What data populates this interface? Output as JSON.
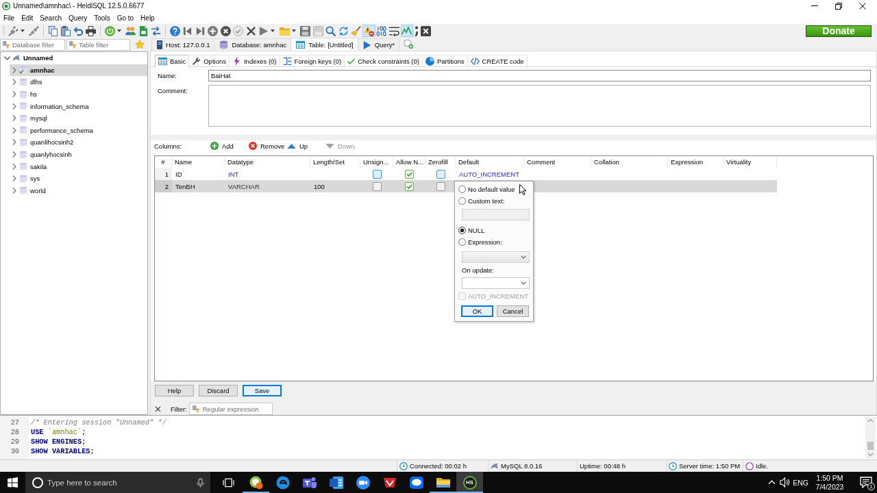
{
  "window": {
    "title": "Unnamed\\amnhac\\ - HeidiSQL 12.5.0.6677"
  },
  "menu": [
    "File",
    "Edit",
    "Search",
    "Query",
    "Tools",
    "Go to",
    "Help"
  ],
  "toolbar": {
    "groups": [
      [
        {
          "pressed": false,
          "dropdown": true
        },
        {
          "pressed": false,
          "dropdown": false
        }
      ],
      [
        {
          "pressed": false,
          "dropdown": false
        },
        {
          "pressed": false,
          "dropdown": false
        },
        {
          "pressed": false,
          "dropdown": false
        },
        {
          "pressed": false,
          "dropdown": false
        }
      ],
      [
        {
          "pressed": false,
          "dropdown": true
        },
        {
          "pressed": false,
          "dropdown": false
        },
        {
          "pressed": false,
          "dropdown": false
        },
        {
          "pressed": false,
          "dropdown": false
        }
      ],
      [
        {
          "pressed": false,
          "dropdown": false
        },
        {
          "pressed": false,
          "dropdown": false
        },
        {
          "pressed": false,
          "dropdown": false
        },
        {
          "pressed": false,
          "dropdown": false
        },
        {
          "pressed": false,
          "dropdown": false
        },
        {
          "pressed": false,
          "dropdown": false
        },
        {
          "pressed": false,
          "dropdown": false
        },
        {
          "pressed": false,
          "dropdown": true
        },
        {
          "pressed": false,
          "dropdown": true
        },
        {
          "pressed": false,
          "dropdown": false
        },
        {
          "pressed": false,
          "dropdown": false
        },
        {
          "pressed": false,
          "dropdown": false
        },
        {
          "pressed": false,
          "dropdown": false
        },
        {
          "pressed": false,
          "dropdown": false
        },
        {
          "pressed": true,
          "dropdown": false
        },
        {
          "pressed": false,
          "dropdown": false
        },
        {
          "pressed": false,
          "dropdown": false
        },
        {
          "pressed": true,
          "dropdown": false
        },
        {
          "pressed": false,
          "dropdown": false
        },
        {
          "pressed": false,
          "dropdown": false
        }
      ]
    ],
    "donate": "Donate"
  },
  "sidebar": {
    "database_filter": {
      "placeholder": "Database filter"
    },
    "table_filter": {
      "placeholder": "Table filter"
    },
    "tree": [
      {
        "label": "Unnamed",
        "expanded": true,
        "selected": false,
        "children": [
          {
            "label": "amnhac",
            "expanded": false,
            "selected": true,
            "active": true
          },
          {
            "label": "dlhs",
            "expanded": false,
            "selected": false,
            "active": false
          },
          {
            "label": "hs",
            "expanded": false,
            "selected": false,
            "active": false
          },
          {
            "label": "information_schema",
            "expanded": false,
            "selected": false,
            "active": false
          },
          {
            "label": "mysql",
            "expanded": false,
            "selected": false,
            "active": false
          },
          {
            "label": "performance_schema",
            "expanded": false,
            "selected": false,
            "active": false
          },
          {
            "label": "quanlihocsinh2",
            "expanded": false,
            "selected": false,
            "active": false
          },
          {
            "label": "quanlyhocsinh",
            "expanded": false,
            "selected": false,
            "active": false
          },
          {
            "label": "sakila",
            "expanded": false,
            "selected": false,
            "active": false
          },
          {
            "label": "sys",
            "expanded": false,
            "selected": false,
            "active": false
          },
          {
            "label": "world",
            "expanded": false,
            "selected": false,
            "active": false
          }
        ]
      }
    ]
  },
  "tabs": [
    {
      "kind": "host",
      "label": "Host: 127.0.0.1",
      "selected": false
    },
    {
      "kind": "database",
      "label": "Database: amnhac",
      "selected": false
    },
    {
      "kind": "table",
      "label": "Table: [Untitled]",
      "selected": true
    },
    {
      "kind": "query",
      "label": "Query*",
      "selected": false
    }
  ],
  "subtabs": [
    {
      "kind": "basic",
      "label": "Basic",
      "selected": true
    },
    {
      "kind": "options",
      "label": "Options",
      "selected": false
    },
    {
      "kind": "indexes",
      "label": "Indexes (0)",
      "selected": false
    },
    {
      "kind": "foreign_keys",
      "label": "Foreign keys (0)",
      "selected": false
    },
    {
      "kind": "check_constraints",
      "label": "Check constraints (0)",
      "selected": false
    },
    {
      "kind": "partitions",
      "label": "Partitions",
      "selected": false
    },
    {
      "kind": "create_code",
      "label": "CREATE code",
      "selected": false
    }
  ],
  "form": {
    "name": {
      "label": "Name:",
      "value": "BaiHat"
    },
    "comment": {
      "label": "Comment:"
    }
  },
  "columns_toolbar": {
    "label": "Columns:",
    "buttons": [
      {
        "kind": "add",
        "label": "Add",
        "disabled": false
      },
      {
        "kind": "remove",
        "label": "Remove",
        "disabled": false
      },
      {
        "kind": "up",
        "label": "Up",
        "disabled": false
      },
      {
        "kind": "down",
        "label": "Down",
        "disabled": true
      }
    ]
  },
  "grid": {
    "columns": [
      "#",
      "Name",
      "Datatype",
      "Length/Set",
      "Unsign...",
      "Allow N...",
      "Zerofill",
      "Default",
      "Comment",
      "Collation",
      "Expression",
      "Virtuality"
    ],
    "rows": [
      {
        "number": "1",
        "name": "ID",
        "datatype": {
          "text": "INT",
          "kind": "integer"
        },
        "unsigned": {
          "checked": false,
          "disabled": false
        },
        "allow_null": {
          "checked": true,
          "disabled": false
        },
        "zerofill": {
          "checked": false,
          "disabled": false
        },
        "default": "AUTO_INCREMENT",
        "selected": false
      },
      {
        "number": "2",
        "name": "TenBH",
        "datatype": {
          "text": "VARCHAR",
          "kind": "text"
        },
        "length": "100",
        "unsigned": {
          "checked": false,
          "disabled": true
        },
        "allow_null": {
          "checked": true,
          "disabled": false
        },
        "zerofill": {
          "checked": false,
          "disabled": true
        },
        "selected": true
      }
    ]
  },
  "default_editor": {
    "items": [
      {
        "kind": "radio",
        "label": "No default value",
        "selected": false
      },
      {
        "kind": "radio",
        "label": "Custom text:",
        "selected": false
      },
      {
        "kind": "input",
        "disabled": true
      },
      {
        "kind": "radio",
        "label": "NULL",
        "selected": true
      },
      {
        "kind": "radio",
        "label": "Expression:",
        "selected": false
      },
      {
        "kind": "select",
        "disabled": true
      },
      {
        "kind": "label",
        "label": "On update:"
      },
      {
        "kind": "select",
        "disabled": false
      },
      {
        "kind": "checkbox",
        "label": "AUTO_INCREMENT",
        "checked": false,
        "disabled": true
      }
    ],
    "buttons": [
      {
        "label": "OK",
        "focused": true
      },
      {
        "label": "Cancel",
        "focused": false
      }
    ]
  },
  "buttons": [
    {
      "label": "Help",
      "focused": false
    },
    {
      "label": "Discard",
      "focused": false
    },
    {
      "label": "Save",
      "focused": true
    }
  ],
  "filter": {
    "label": "Filter:",
    "placeholder": "Regular expression"
  },
  "sql_log": {
    "lines": [
      {
        "number": "27",
        "tokens": [
          {
            "kind": "comment",
            "text": "/* Entering session \"Unnamed\" */"
          }
        ]
      },
      {
        "number": "28",
        "tokens": [
          {
            "kind": "keyword",
            "text": "USE "
          },
          {
            "kind": "identifier",
            "text": "`amnhac`"
          },
          {
            "kind": "plain",
            "text": ";"
          }
        ]
      },
      {
        "number": "29",
        "tokens": [
          {
            "kind": "keyword",
            "text": "SHOW ENGINES"
          },
          {
            "kind": "plain",
            "text": ";"
          }
        ]
      },
      {
        "number": "30",
        "tokens": [
          {
            "kind": "keyword",
            "text": "SHOW VARIABLES"
          },
          {
            "kind": "plain",
            "text": ";"
          }
        ]
      }
    ]
  },
  "status_bar": [
    {
      "kind": "connection",
      "text": "Connected: 00:02 h"
    },
    {
      "kind": "server",
      "text": "MySQL 8.0.16"
    },
    {
      "kind": "uptime",
      "text": "Uptime: 00:48 h"
    },
    {
      "kind": "clock",
      "text": "Server time: 1:50 PM"
    },
    {
      "kind": "idle",
      "text": "Idle."
    }
  ],
  "taskbar": {
    "search": {
      "placeholder": "Type here to search"
    },
    "apps": [
      {
        "running": true,
        "active": false
      },
      {
        "running": false,
        "active": false
      },
      {
        "running": false,
        "active": false
      },
      {
        "running": false,
        "active": false
      },
      {
        "running": false,
        "active": false
      },
      {
        "running": false,
        "active": false
      },
      {
        "running": false,
        "active": false
      },
      {
        "running": true,
        "active": false
      },
      {
        "running": true,
        "active": true,
        "text": "HS"
      }
    ],
    "tray": {
      "language": "ENG",
      "time": "1:50 PM",
      "date": "7/4/2023",
      "notifications": "1"
    }
  }
}
